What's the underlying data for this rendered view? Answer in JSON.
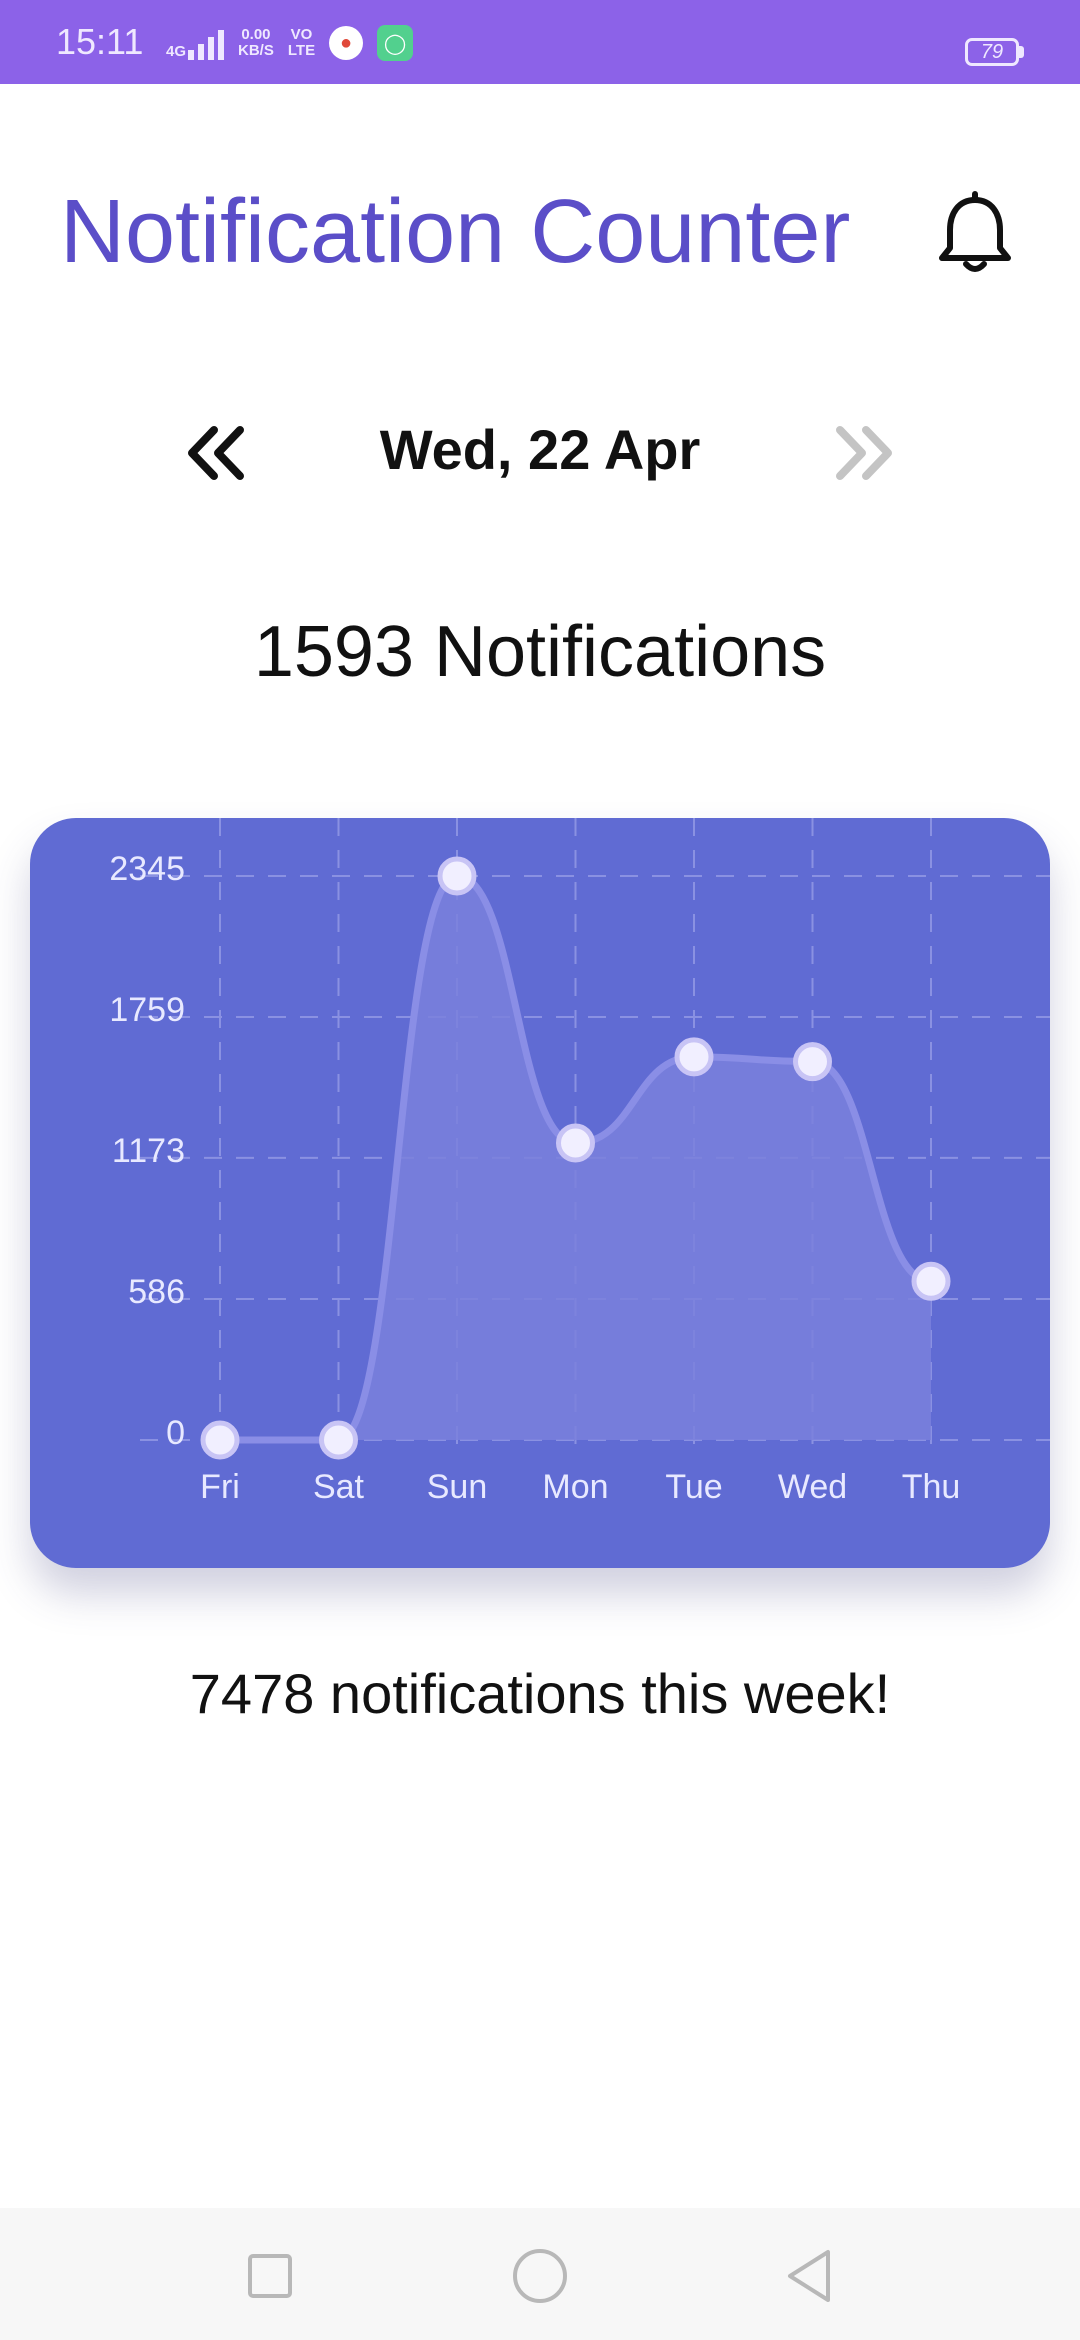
{
  "status_bar": {
    "time": "15:11",
    "network": "4G",
    "speed_value": "0.00",
    "speed_unit": "KB/S",
    "volte_top": "VO",
    "volte_bottom": "LTE",
    "battery": "79",
    "bg_color": "#8c62e8"
  },
  "app": {
    "title": "Notification Counter",
    "bell_icon": "bell-icon",
    "title_color": "#5b4ec8"
  },
  "date_nav": {
    "prev_icon": "double-chevron-left-icon",
    "date": "Wed, 22 Apr",
    "next_icon": "double-chevron-right-icon",
    "next_disabled": true
  },
  "day_count": "1593 Notifications",
  "week_total": "7478 notifications this week!",
  "chart_data": {
    "type": "area",
    "categories": [
      "Fri",
      "Sat",
      "Sun",
      "Mon",
      "Tue",
      "Wed",
      "Thu"
    ],
    "values": [
      0,
      0,
      2345,
      1235,
      1593,
      1573,
      660
    ],
    "y_ticks": [
      "0",
      "586",
      "1173",
      "1759",
      "2345"
    ],
    "ylim": [
      0,
      2345
    ],
    "grid": "dashed",
    "colors": {
      "background": "#606bd3",
      "line": "#8a8ee6",
      "fill": "#7a80dc",
      "point": "#f1efff",
      "point_stroke": "#c8c4f5",
      "text": "#e8e9ff"
    }
  },
  "nav_bar": {
    "recents_icon": "square-icon",
    "home_icon": "circle-icon",
    "back_icon": "triangle-back-icon"
  }
}
